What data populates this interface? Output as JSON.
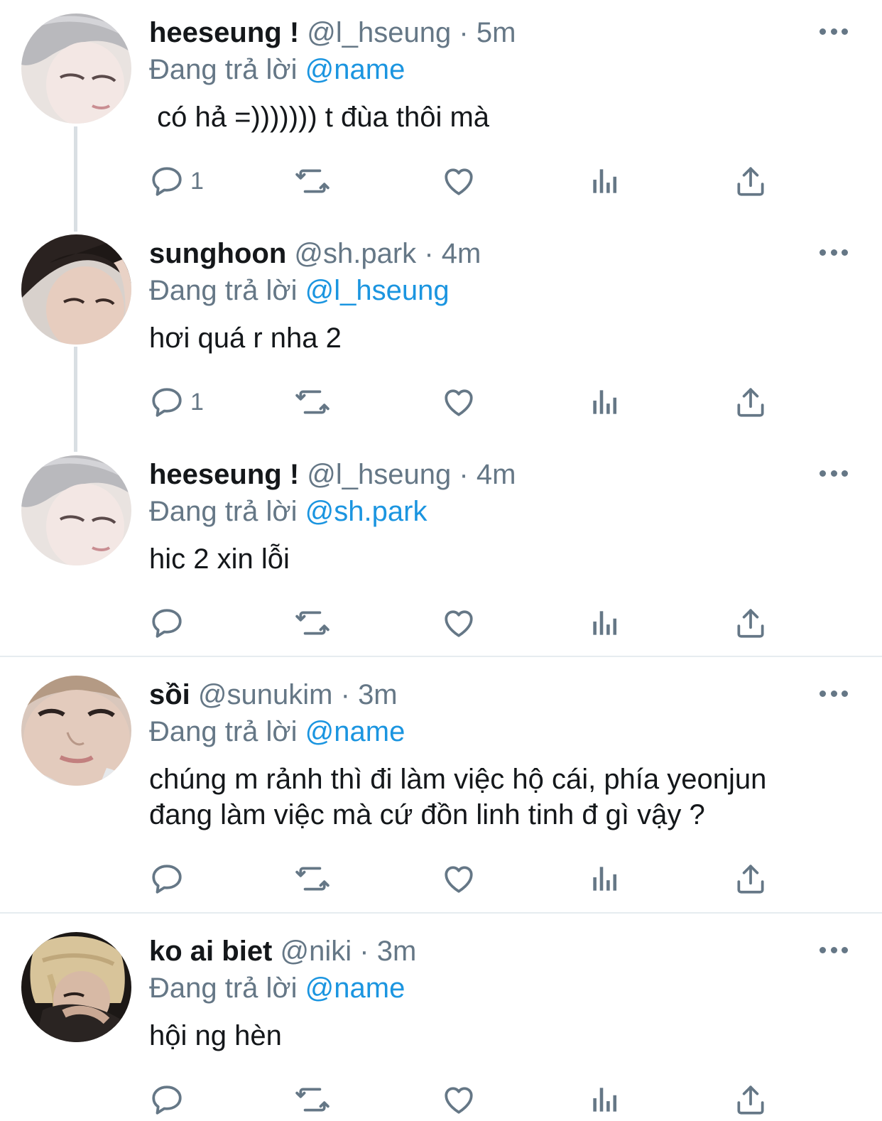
{
  "tweets": [
    {
      "name": "heeseung !",
      "handle": "@l_hseung",
      "dot": "·",
      "time": "5m",
      "reply_prefix": "Đang trả lời",
      "reply_to": "@name",
      "text": " có hả =))))))) t đùa thôi mà",
      "reply_count": "1",
      "avatar": "avatar-gray-hair"
    },
    {
      "name": "sunghoon",
      "handle": "@sh.park",
      "dot": "·",
      "time": "4m",
      "reply_prefix": "Đang trả lời",
      "reply_to": "@l_hseung",
      "text": "hơi quá r nha 2",
      "reply_count": "1",
      "avatar": "avatar-dark-hair"
    },
    {
      "name": "heeseung !",
      "handle": "@l_hseung",
      "dot": "·",
      "time": "4m",
      "reply_prefix": "Đang trả lời",
      "reply_to": "@sh.park",
      "text": "hic 2 xin lỗi",
      "reply_count": "",
      "avatar": "avatar-gray-hair"
    },
    {
      "name": "sồi",
      "handle": "@sunukim",
      "dot": "·",
      "time": "3m",
      "reply_prefix": "Đang trả lời",
      "reply_to": "@name",
      "text_lines": [
        "chúng m rảnh thì đi làm việc hộ cái, phía yeonjun",
        "đang làm việc mà cứ đồn linh tinh đ gì vậy ?"
      ],
      "reply_count": "",
      "avatar": "avatar-closeup"
    },
    {
      "name": "ko ai biet",
      "handle": "@niki",
      "dot": "·",
      "time": "3m",
      "reply_prefix": "Đang trả lời",
      "reply_to": "@name",
      "text": "hội ng hèn",
      "reply_count": "",
      "avatar": "avatar-blonde-hair"
    }
  ],
  "icons": {
    "reply": "reply-icon",
    "retweet": "retweet-icon",
    "like": "heart-icon",
    "views": "analytics-icon",
    "share": "share-icon",
    "more": "more-icon"
  },
  "colors": {
    "text": "#14171a",
    "secondary": "#657786",
    "mention": "#1b95e0",
    "divider": "#e6ecf0",
    "thread_line": "#d9dfe3"
  }
}
